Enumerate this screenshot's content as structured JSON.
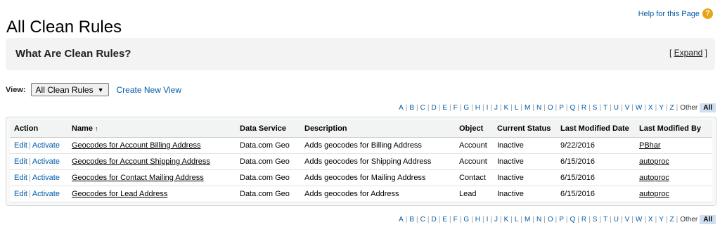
{
  "page_title": "All Clean Rules",
  "help": {
    "label": "Help for this Page",
    "icon": "question-icon"
  },
  "info": {
    "title": "What Are Clean Rules?",
    "expand_open": "[ ",
    "expand_label": "Expand",
    "expand_close": " ]"
  },
  "view": {
    "label": "View:",
    "selected": "All Clean Rules",
    "create_label": "Create New View"
  },
  "alpha": {
    "letters": [
      "A",
      "B",
      "C",
      "D",
      "E",
      "F",
      "G",
      "H",
      "I",
      "J",
      "K",
      "L",
      "M",
      "N",
      "O",
      "P",
      "Q",
      "R",
      "S",
      "T",
      "U",
      "V",
      "W",
      "X",
      "Y",
      "Z"
    ],
    "other": "Other",
    "all": "All"
  },
  "table": {
    "headers": {
      "action": "Action",
      "name": "Name",
      "sort": "↑",
      "service": "Data Service",
      "description": "Description",
      "object": "Object",
      "status": "Current Status",
      "modified_date": "Last Modified Date",
      "modified_by": "Last Modified By"
    },
    "edit_label": "Edit",
    "activate_label": "Activate",
    "rows": [
      {
        "name": "Geocodes for Account Billing Address",
        "service": "Data.com Geo",
        "description": "Adds geocodes for Billing Address",
        "object": "Account",
        "status": "Inactive",
        "date": "9/22/2016",
        "by": "PBhar"
      },
      {
        "name": "Geocodes for Account Shipping Address",
        "service": "Data.com Geo",
        "description": "Adds geocodes for Shipping Address",
        "object": "Account",
        "status": "Inactive",
        "date": "6/15/2016",
        "by": "autoproc"
      },
      {
        "name": "Geocodes for Contact Mailing Address",
        "service": "Data.com Geo",
        "description": "Adds geocodes for Mailing Address",
        "object": "Contact",
        "status": "Inactive",
        "date": "6/15/2016",
        "by": "autoproc"
      },
      {
        "name": "Geocodes for Lead Address",
        "service": "Data.com Geo",
        "description": "Adds geocodes for Address",
        "object": "Lead",
        "status": "Inactive",
        "date": "6/15/2016",
        "by": "autoproc"
      }
    ]
  }
}
